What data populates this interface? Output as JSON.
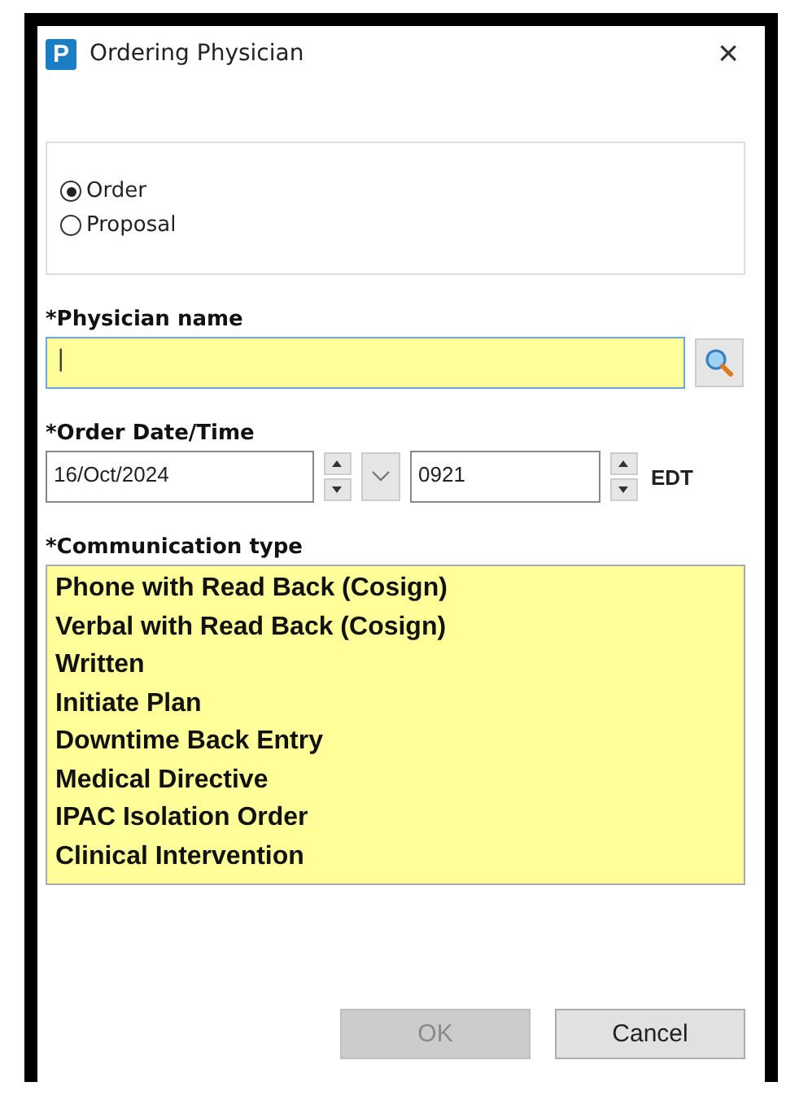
{
  "window": {
    "title": "Ordering Physician",
    "app_letter": "P",
    "close": "×"
  },
  "order_kind": [
    {
      "label": "Order",
      "selected": true
    },
    {
      "label": "Proposal",
      "selected": false
    }
  ],
  "physician": {
    "label": "*Physician name",
    "value": "|"
  },
  "order_datetime": {
    "label": "*Order Date/Time",
    "date": "16/Oct/2024",
    "time": "0921",
    "zone": "EDT"
  },
  "communication": {
    "label": "*Communication type",
    "items": [
      {
        "label": "Phone with Read Back (Cosign)",
        "selected": false
      },
      {
        "label": "Verbal with Read Back (Cosign)",
        "selected": false
      },
      {
        "label": "Written",
        "selected": false
      },
      {
        "label": "Initiate Plan",
        "selected": false
      },
      {
        "label": "Downtime Back Entry",
        "selected": false
      },
      {
        "label": "Medical Directive",
        "selected": false
      },
      {
        "label": "IPAC Isolation Order",
        "selected": false
      },
      {
        "label": "Clinical Intervention",
        "selected": false
      }
    ]
  },
  "buttons": [
    {
      "label": "OK",
      "disabled": true
    },
    {
      "label": "Cancel",
      "disabled": false
    }
  ]
}
